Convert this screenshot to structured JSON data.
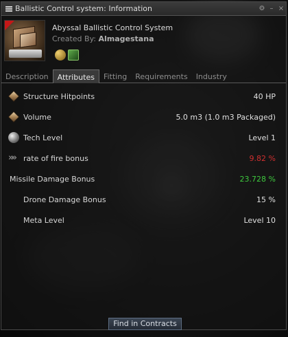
{
  "window": {
    "title": "Ballistic Control system: Information",
    "controls": [
      "⚙",
      "–",
      "×"
    ]
  },
  "item": {
    "name": "Abyssal Ballistic Control System",
    "created_prefix": "Created By:",
    "created_by": "Almagestana"
  },
  "tabs": [
    {
      "label": "Description",
      "active": false
    },
    {
      "label": "Attributes",
      "active": true
    },
    {
      "label": "Fitting",
      "active": false
    },
    {
      "label": "Requirements",
      "active": false
    },
    {
      "label": "Industry",
      "active": false
    }
  ],
  "attributes": [
    {
      "label": "Structure Hitpoints",
      "value": "40 HP",
      "icon": "cube-icon",
      "status": "normal"
    },
    {
      "label": "Volume",
      "value": "5.0 m3 (1.0 m3 Packaged)",
      "icon": "cube-icon",
      "status": "normal"
    },
    {
      "label": "Tech Level",
      "value": "Level 1",
      "icon": "tech-level-icon",
      "status": "normal"
    },
    {
      "label": "rate of fire bonus",
      "value": "9.82 %",
      "icon": "rate-of-fire-icon",
      "status": "negative"
    },
    {
      "label": "Missile Damage Bonus",
      "value": "23.728 %",
      "icon": "",
      "status": "positive"
    },
    {
      "label": "Drone Damage Bonus",
      "value": "15 %",
      "icon": "",
      "status": "normal"
    },
    {
      "label": "Meta Level",
      "value": "Level 10",
      "icon": "",
      "status": "normal"
    }
  ],
  "footer": {
    "find_contracts_label": "Find in Contracts"
  },
  "colors": {
    "negative": "#d03030",
    "positive": "#3ec83e"
  }
}
